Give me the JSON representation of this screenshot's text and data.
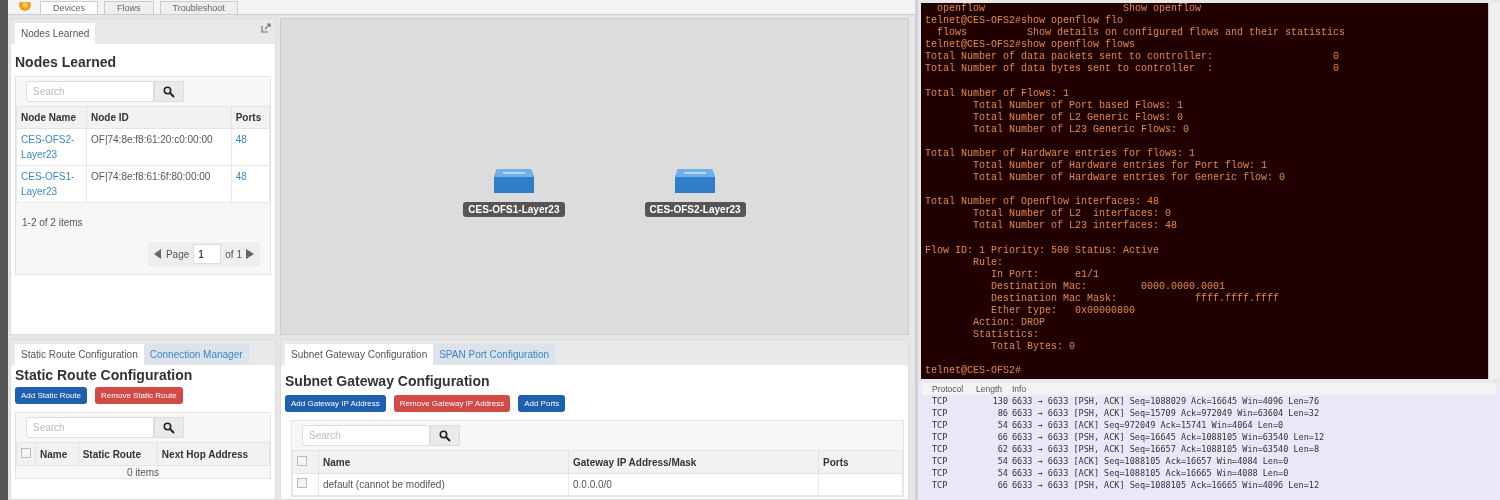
{
  "nav": {
    "tabs": [
      {
        "label": "Devices",
        "selected": true
      },
      {
        "label": "Flows",
        "selected": false
      },
      {
        "label": "Troubleshoot",
        "selected": false
      }
    ]
  },
  "nodes_panel": {
    "tab": {
      "label": "Nodes Learned",
      "selected": true
    },
    "title": "Nodes Learned",
    "search": {
      "placeholder": "Search"
    },
    "columns": [
      "Node Name",
      "Node ID",
      "Ports"
    ],
    "rows": [
      {
        "name": "CES-OFS2-Layer23",
        "id": "OF|74:8e:f8:61:20:c0:00:00",
        "ports": "48"
      },
      {
        "name": "CES-OFS1-Layer23",
        "id": "OF|74:8e:f8:61:6f:80:00:00",
        "ports": "48"
      }
    ],
    "summary": "1-2 of 2 items",
    "pager": {
      "label": "Page",
      "value": "1",
      "of": "of 1"
    }
  },
  "topology": {
    "nodes": [
      {
        "label": "CES-OFS1-Layer23"
      },
      {
        "label": "CES-OFS2-Layer23"
      }
    ]
  },
  "static_panel": {
    "tabs": [
      {
        "label": "Static Route Configuration",
        "selected": true
      },
      {
        "label": "Connection Manager",
        "selected": false
      }
    ],
    "title": "Static Route Configuration",
    "buttons": [
      {
        "label": "Add Static Route",
        "kind": "primary"
      },
      {
        "label": "Remove Static Route",
        "kind": "danger"
      }
    ],
    "search": {
      "placeholder": "Search"
    },
    "header_checked": false,
    "columns": [
      "Name",
      "Static Route",
      "Next Hop Address"
    ],
    "summary": "0 items"
  },
  "subnet_panel": {
    "tabs": [
      {
        "label": "Subnet Gateway Configuration",
        "selected": true
      },
      {
        "label": "SPAN Port Configuration",
        "selected": false
      }
    ],
    "title": "Subnet Gateway Configuration",
    "buttons": [
      {
        "label": "Add Gateway IP Address",
        "kind": "primary"
      },
      {
        "label": "Remove Gateway IP Address",
        "kind": "danger"
      },
      {
        "label": "Add Ports",
        "kind": "primary"
      }
    ],
    "search": {
      "placeholder": "Search"
    },
    "header_checked": false,
    "columns": [
      "Name",
      "Gateway IP Address/Mask",
      "Ports"
    ],
    "rows": [
      {
        "checked": false,
        "name": "default (cannot be modifed)",
        "gateway": "0.0.0.0/0",
        "ports": ""
      }
    ]
  },
  "terminal": {
    "blocks": [
      [
        "  openflow                       Show openflow",
        "telnet@CES-OFS2#show openflow flo",
        "  flows          Show details on configured flows and their statistics",
        "telnet@CES-OFS2#show openflow flows",
        "Total Number of data packets sent to controller:                    0",
        "Total Number of data bytes sent to controller  :                    0"
      ],
      [
        "Total Number of Flows: 1",
        "        Total Number of Port based Flows: 1",
        "        Total Number of L2 Generic Flows: 0",
        "        Total Number of L23 Generic Flows: 0"
      ],
      [
        "Total Number of Hardware entries for flows: 1",
        "        Total Number of Hardware entries for Port flow: 1",
        "        Total Number of Hardware entries for Generic flow: 0"
      ],
      [
        "Total Number of Openflow interfaces: 48",
        "        Total Number of L2  interfaces: 0",
        "        Total Number of L23 interfaces: 48"
      ],
      [
        "Flow ID: 1 Priority: 500 Status: Active",
        "        Rule:",
        "           In Port:      e1/1",
        "           Destination Mac:         0000.0000.0001",
        "           Destination Mac Mask:             ffff.ffff.ffff",
        "           Ether type:   0x00000800",
        "        Action: DROP",
        "        Statistics:",
        "           Total Bytes: 0"
      ],
      [
        "telnet@CES-OFS2#"
      ]
    ]
  },
  "packets": {
    "columns": [
      "Protocol",
      "Length",
      "Info"
    ],
    "rows": [
      {
        "protocol": "TCP",
        "length": "130",
        "info": "6633 → 6633 [PSH, ACK] Seq=1088029 Ack=16645 Win=4096 Len=76"
      },
      {
        "protocol": "TCP",
        "length": "86",
        "info": "6633 → 6633 [PSH, ACK] Seq=15709 Ack=972049 Win=63604 Len=32"
      },
      {
        "protocol": "TCP",
        "length": "54",
        "info": "6633 → 6633 [ACK] Seq=972049 Ack=15741 Win=4064 Len=0"
      },
      {
        "protocol": "TCP",
        "length": "66",
        "info": "6633 → 6633 [PSH, ACK] Seq=16645 Ack=1088105 Win=63540 Len=12"
      },
      {
        "protocol": "TCP",
        "length": "62",
        "info": "6633 → 6633 [PSH, ACK] Seq=16657 Ack=1088105 Win=63540 Len=8"
      },
      {
        "protocol": "TCP",
        "length": "54",
        "info": "6633 → 6633 [ACK] Seq=1088105 Ack=16657 Win=4084 Len=0"
      },
      {
        "protocol": "TCP",
        "length": "54",
        "info": "6633 → 6633 [ACK] Seq=1088105 Ack=16665 Win=4088 Len=0"
      },
      {
        "protocol": "TCP",
        "length": "66",
        "info": "6633 → 6633 [PSH, ACK] Seq=1088105 Ack=16665 Win=4096 Len=12"
      }
    ]
  }
}
